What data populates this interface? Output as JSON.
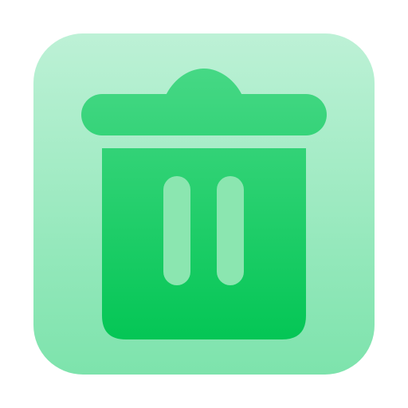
{
  "icon": {
    "name": "trash-icon",
    "colors": {
      "tile_top": "#BDF1D6",
      "tile_bottom": "#7DE3AC",
      "bin_top": "#46D885",
      "bin_bottom": "#04C655",
      "slot": "#8BE6B0"
    }
  }
}
